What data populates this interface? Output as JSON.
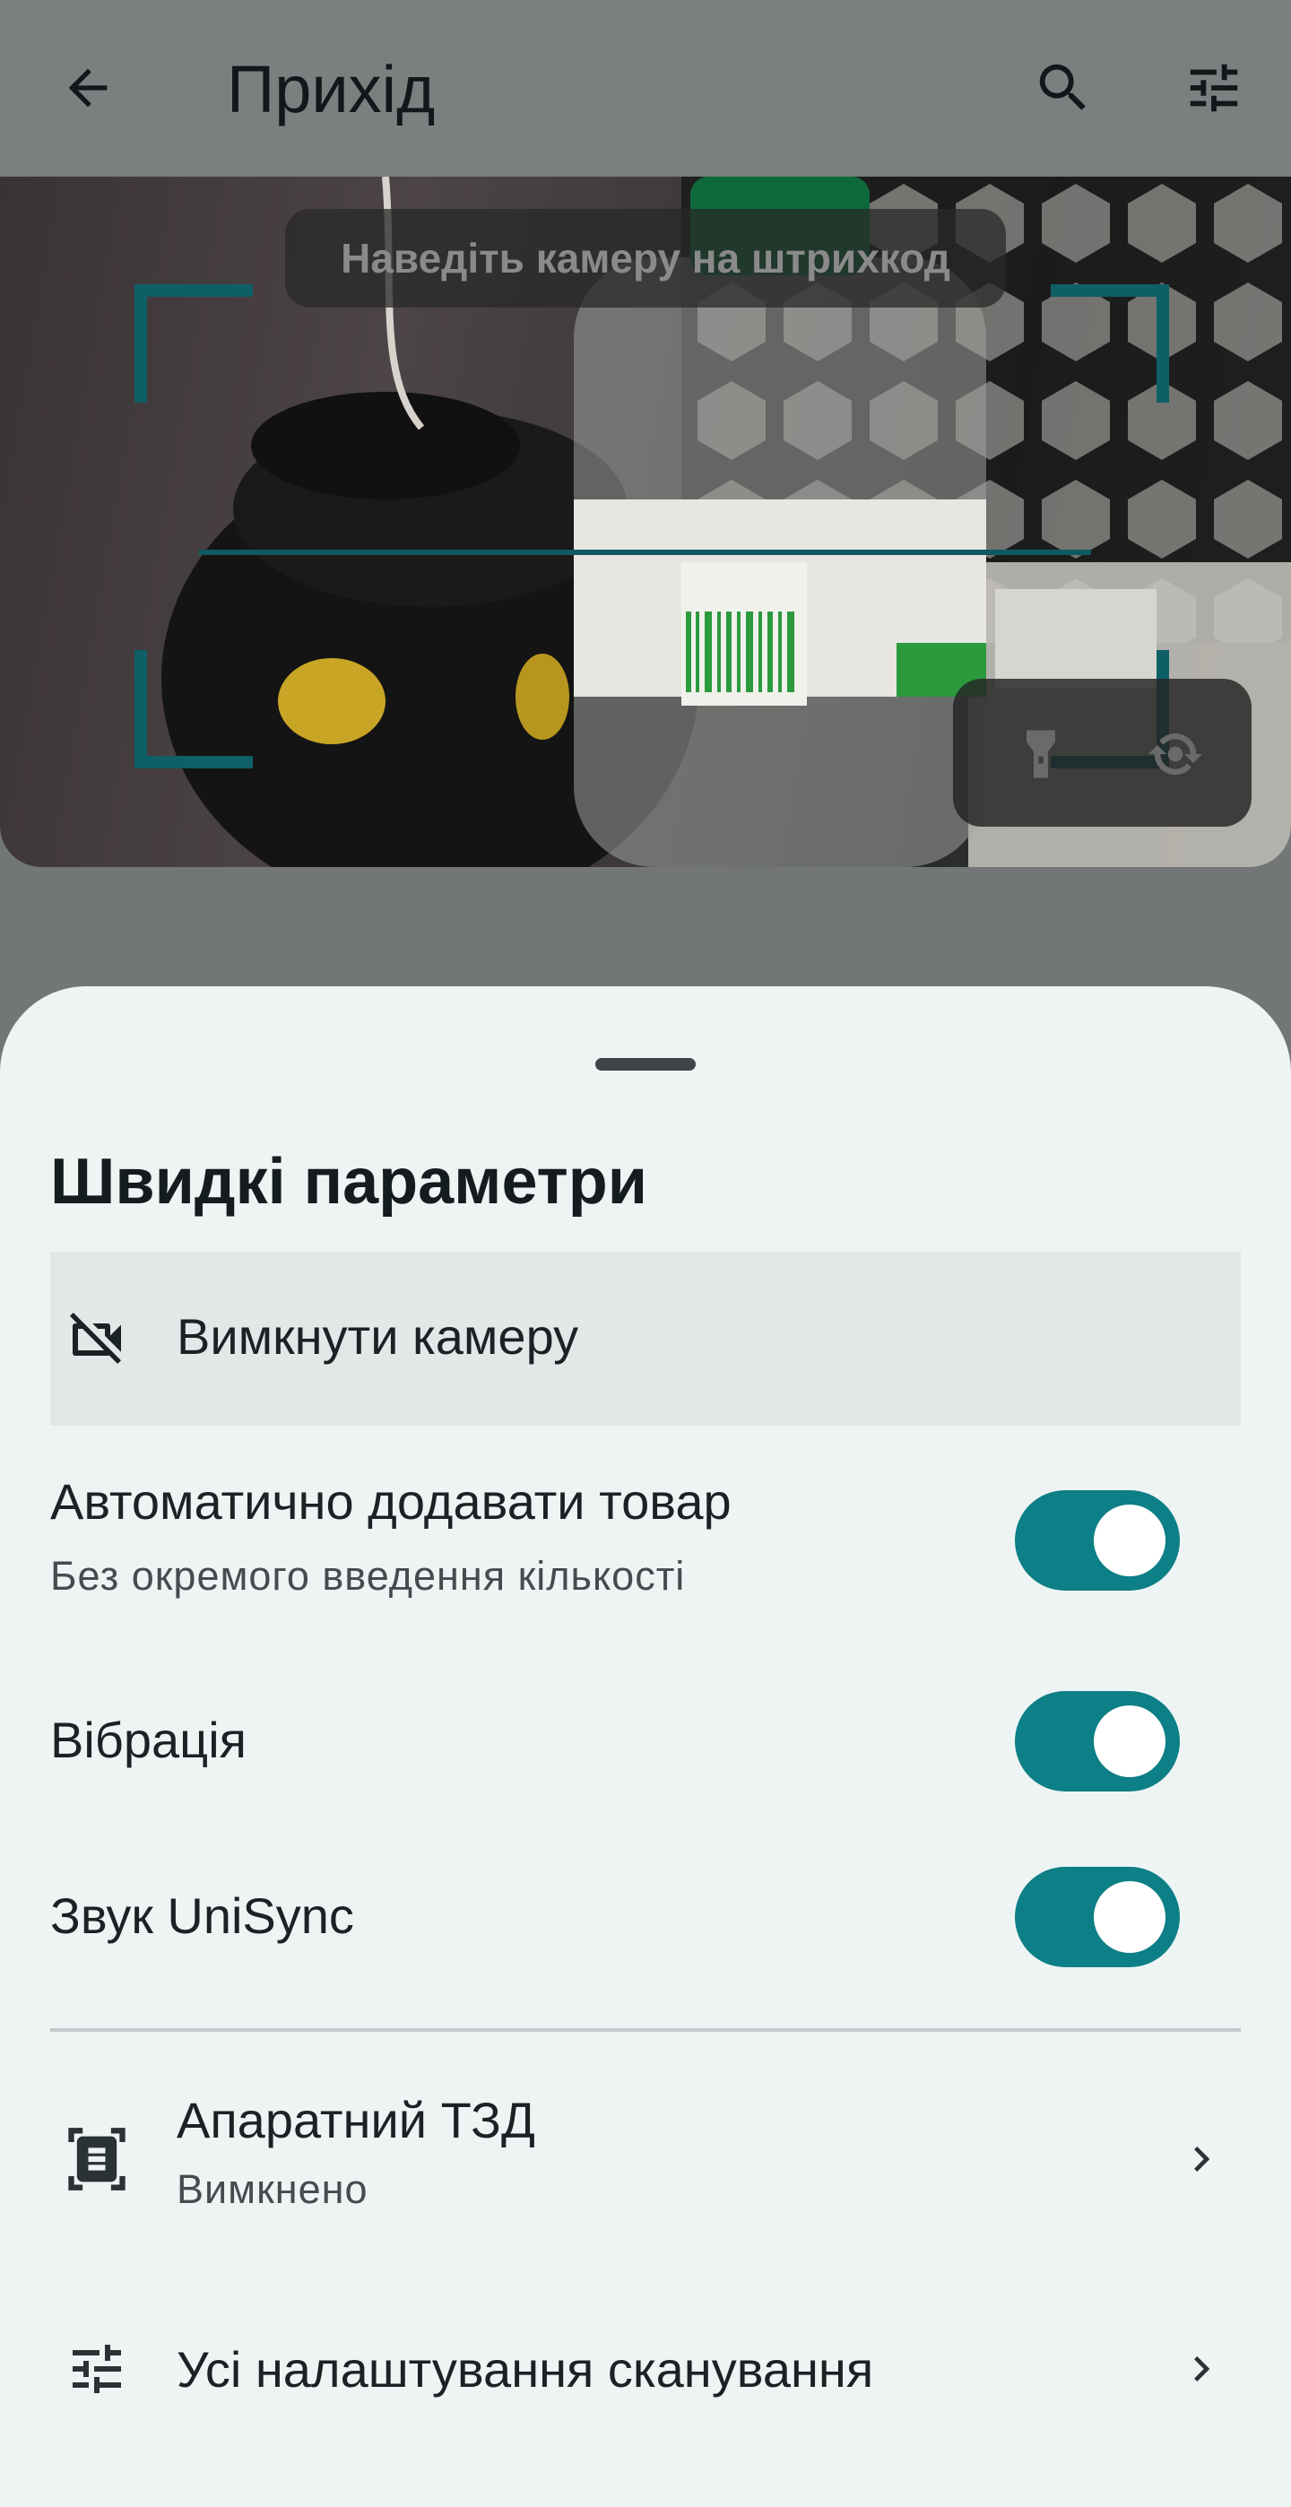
{
  "app_bar": {
    "title": "Прихід",
    "back_icon": "arrow-back-icon",
    "search_icon": "search-icon",
    "filter_icon": "tune-icon"
  },
  "camera": {
    "hint": "Наведіть камеру на штрихкод",
    "flash_icon": "flashlight-icon",
    "flip_icon": "flip-camera-icon",
    "accent_color": "#0f5f66"
  },
  "sheet": {
    "title": "Швидкі параметри",
    "camera_off": {
      "label": "Вимкнути камеру",
      "icon": "videocam-off-icon"
    },
    "toggles": [
      {
        "label": "Автоматично додавати товар",
        "sublabel": "Без окремого введення кількості",
        "on": true
      },
      {
        "label": "Вібрація",
        "on": true
      },
      {
        "label": "Звук UniSync",
        "on": true
      }
    ],
    "nav": [
      {
        "label": "Апаратний ТЗД",
        "sublabel": "Вимкнено",
        "icon": "document-scanner-icon"
      },
      {
        "label": "Усі налаштування сканування",
        "icon": "tune-icon"
      }
    ],
    "switch_color": "#0d7f86"
  }
}
